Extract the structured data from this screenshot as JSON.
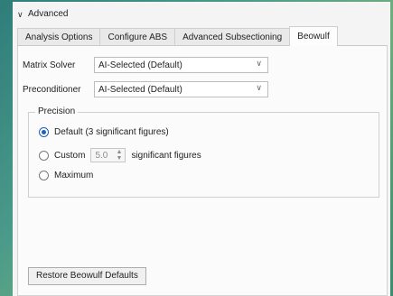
{
  "section": {
    "title": "Advanced",
    "icon": "chevron-down-icon"
  },
  "tabs": [
    {
      "label": "Analysis Options",
      "active": false
    },
    {
      "label": "Configure ABS",
      "active": false
    },
    {
      "label": "Advanced Subsectioning",
      "active": false
    },
    {
      "label": "Beowulf",
      "active": true
    }
  ],
  "form": {
    "matrix_solver_label": "Matrix Solver",
    "matrix_solver_value": "AI-Selected (Default)",
    "preconditioner_label": "Preconditioner",
    "preconditioner_value": "AI-Selected (Default)"
  },
  "precision": {
    "title": "Precision",
    "default_label": "Default (3 significant figures)",
    "custom_label": "Custom",
    "custom_value": "5.0",
    "custom_suffix": "significant figures",
    "maximum_label": "Maximum",
    "selected": "default"
  },
  "restore_button": "Restore Beowulf Defaults",
  "colors": {
    "accent": "#1f5fbf",
    "panel_bg": "#f4f4f4"
  }
}
